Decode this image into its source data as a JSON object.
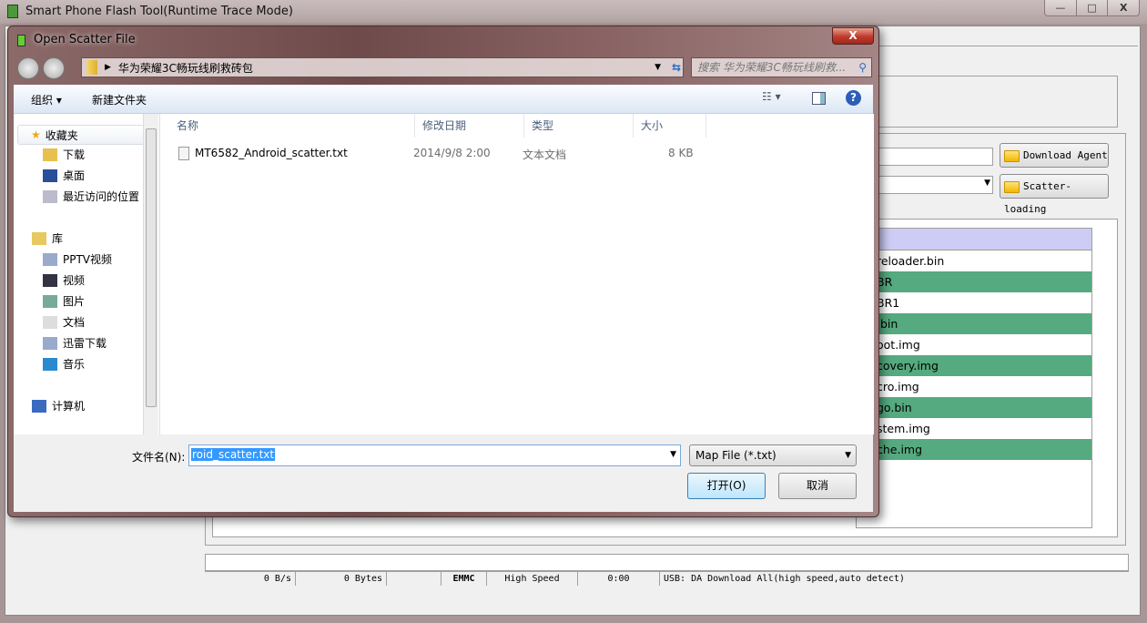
{
  "app": {
    "title": "Smart Phone Flash Tool(Runtime Trace Mode)",
    "window_buttons": [
      "—",
      "□",
      "X"
    ],
    "download_agent_label": "Download Agent",
    "scatter_loading_label": "Scatter-loading",
    "partition_rows": [
      "reloader.bin",
      "BR",
      "BR1",
      ".bin",
      "oot.img",
      "covery.img",
      "cro.img",
      "go.bin",
      "stem.img",
      "che.img"
    ],
    "status": {
      "speed": "0 B/s",
      "bytes": "0 Bytes",
      "blank": "",
      "storage": "EMMC",
      "mode": "High Speed",
      "time": "0:00",
      "usb": "USB: DA Download All(high speed,auto detect)"
    },
    "colors": {
      "header": "#ccccf5",
      "row_green": "#55aa7f"
    }
  },
  "dialog": {
    "title": "Open Scatter File",
    "close_label": "X",
    "address": "华为荣耀3C畅玩线刷救砖包",
    "search_placeholder": "搜索 华为荣耀3C畅玩线刷救...",
    "toolbar": {
      "organize": "组织 ▾",
      "new_folder": "新建文件夹"
    },
    "nav": {
      "favorites": "收藏夹",
      "fav_items": [
        "下载",
        "桌面",
        "最近访问的位置"
      ],
      "libraries": "库",
      "lib_items": [
        "PPTV视频",
        "视频",
        "图片",
        "文档",
        "迅雷下载",
        "音乐"
      ],
      "computer": "计算机"
    },
    "columns": [
      "名称",
      "修改日期",
      "类型",
      "大小"
    ],
    "files": [
      {
        "name": "MT6582_Android_scatter.txt",
        "date": "2014/9/8 2:00",
        "type": "文本文档",
        "size": "8 KB"
      }
    ],
    "filename_label": "文件名(N):",
    "filename_value": "roid_scatter.txt",
    "filter": "Map File (*.txt)",
    "open_label": "打开(O)",
    "cancel_label": "取消"
  }
}
